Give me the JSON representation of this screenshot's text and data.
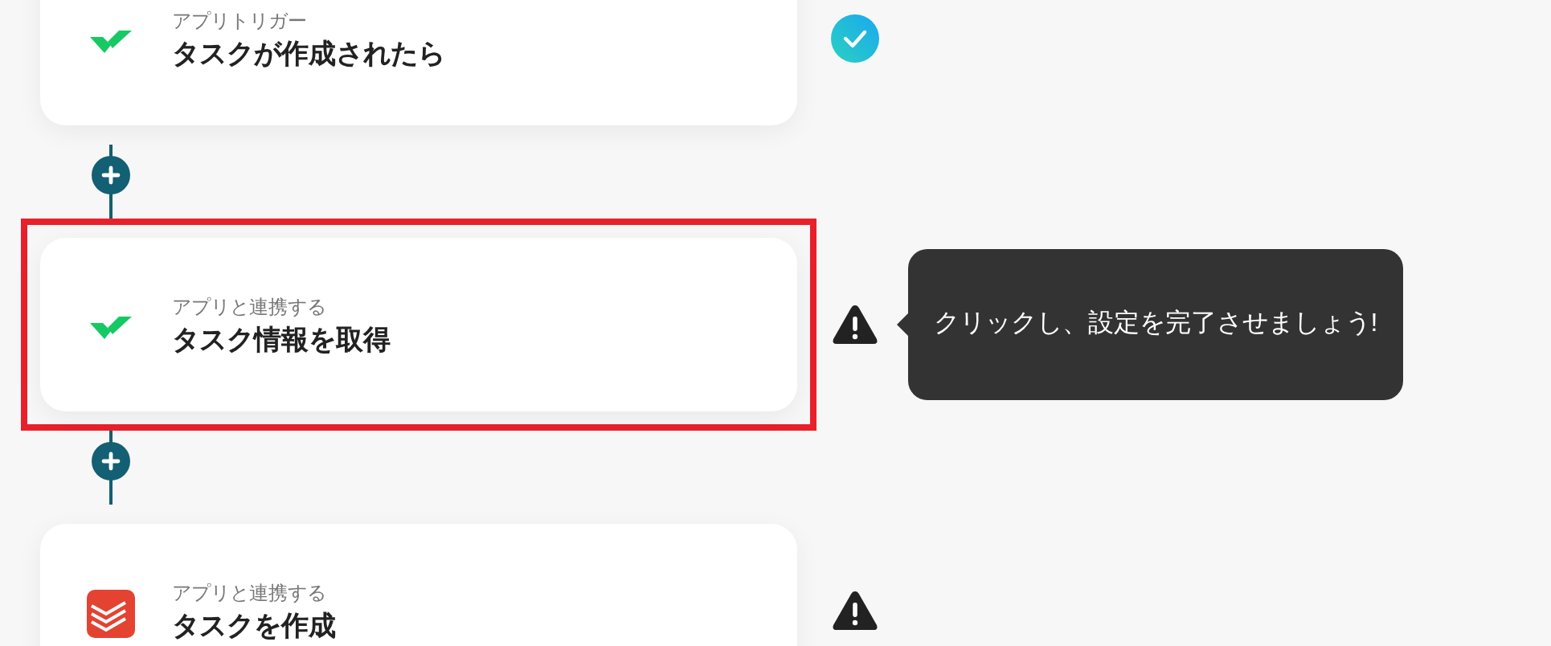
{
  "steps": [
    {
      "kind": "wrike",
      "label": "アプリトリガー",
      "title": "タスクが作成されたら",
      "done": true,
      "selected": false
    },
    {
      "kind": "wrike",
      "label": "アプリと連携する",
      "title": "タスク情報を取得",
      "done": false,
      "selected": true,
      "tooltip": "クリックし、設定を完了させましょう!"
    },
    {
      "kind": "todoist",
      "label": "アプリと連携する",
      "title": "タスクを作成",
      "done": false,
      "selected": false
    }
  ]
}
